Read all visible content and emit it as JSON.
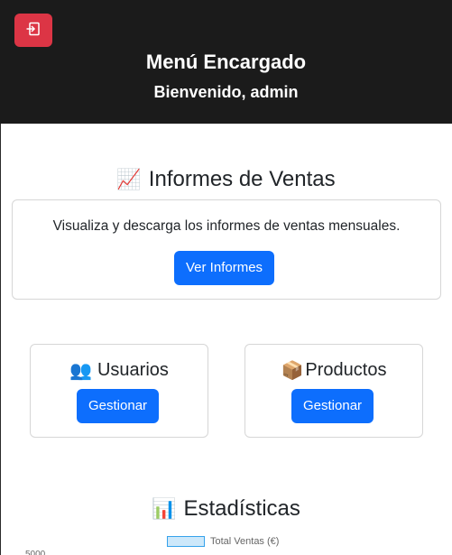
{
  "header": {
    "title": "Menú Encargado",
    "welcome": "Bienvenido, admin",
    "logout_icon": "logout-icon",
    "logout_color": "#dc3545"
  },
  "reports": {
    "title": "Informes de Ventas",
    "emoji": "📈",
    "description": "Visualiza y descarga los informes de ventas mensuales.",
    "button_label": "Ver Informes"
  },
  "cards": [
    {
      "title": "Usuarios",
      "emoji": "👥",
      "button_label": "Gestionar"
    },
    {
      "title": "Productos",
      "emoji": "📦",
      "button_label": "Gestionar"
    }
  ],
  "stats": {
    "title": "Estadísticas",
    "emoji": "📊"
  },
  "chart_data": {
    "type": "bar",
    "series": [
      {
        "name": "Total Ventas (€)",
        "values": []
      }
    ],
    "y_tick_top": "5000",
    "legend_position": "top",
    "colors": {
      "fill": "rgba(54,162,235,0.25)",
      "border": "#36a2eb"
    }
  },
  "theme": {
    "header_bg": "#1b1b1b",
    "primary": "#0d6efd",
    "danger": "#dc3545"
  }
}
